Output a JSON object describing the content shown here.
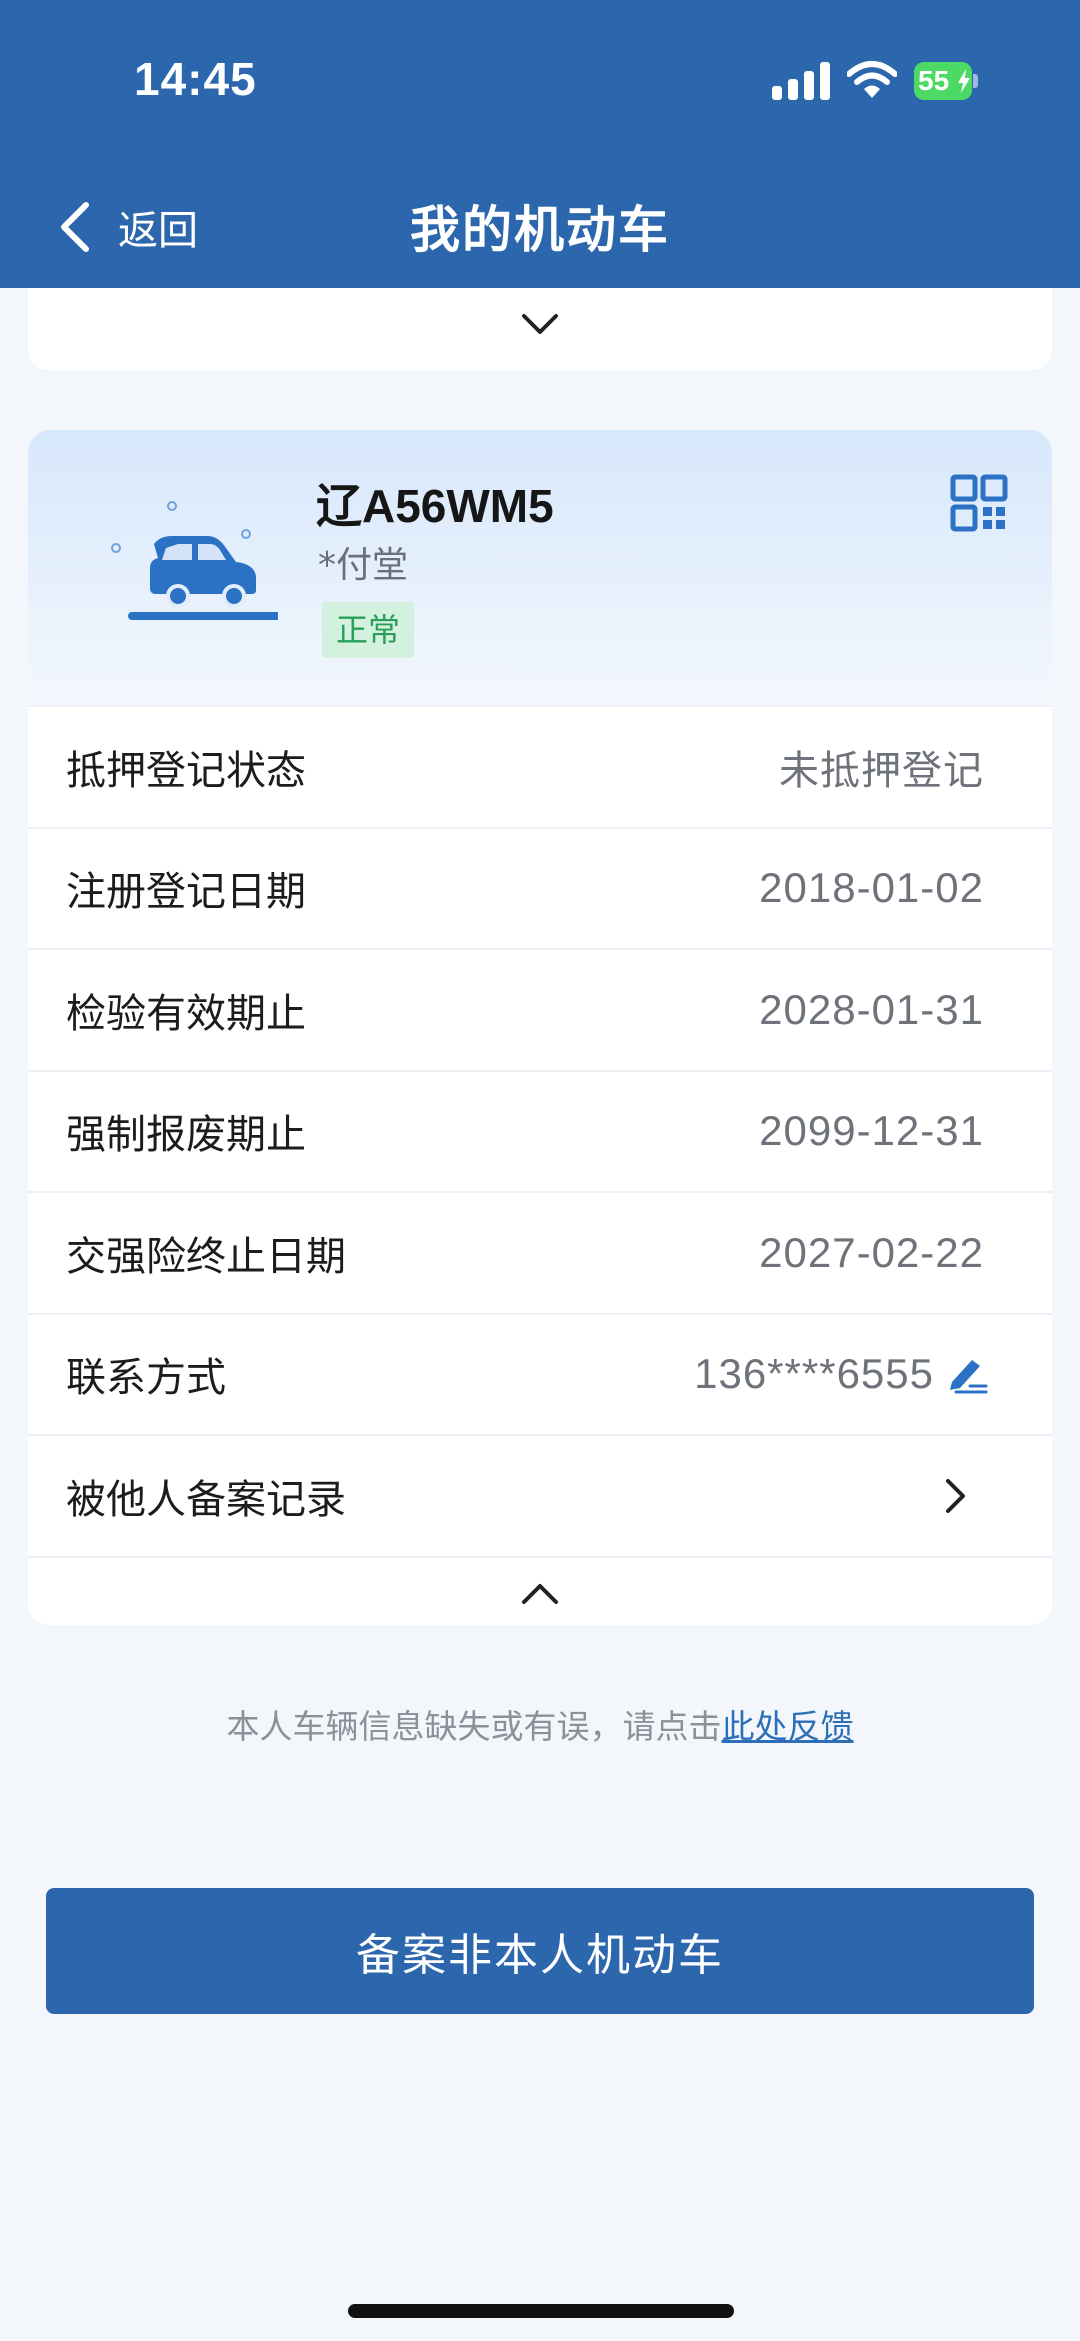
{
  "status_bar": {
    "time": "14:45",
    "battery": "55"
  },
  "nav": {
    "back_label": "返回",
    "title": "我的机动车"
  },
  "vehicle": {
    "plate": "辽A56WM5",
    "owner": "*付堂",
    "status": "正常"
  },
  "info_rows": [
    {
      "label": "抵押登记状态",
      "value": "未抵押登记"
    },
    {
      "label": "注册登记日期",
      "value": "2018-01-02"
    },
    {
      "label": "检验有效期止",
      "value": "2028-01-31"
    },
    {
      "label": "强制报废期止",
      "value": "2099-12-31"
    },
    {
      "label": "交强险终止日期",
      "value": "2027-02-22"
    },
    {
      "label": "联系方式",
      "value": "136****6555"
    },
    {
      "label": "被他人备案记录",
      "value": ""
    }
  ],
  "feedback": {
    "text": "本人车辆信息缺失或有误，请点击",
    "link": "此处反馈"
  },
  "primary_button": {
    "label": "备案非本人机动车"
  },
  "colors": {
    "brand": "#2c66ad",
    "badge_bg": "#d4f0de",
    "badge_text": "#2b9f5a"
  },
  "icons": [
    "signal-icon",
    "wifi-icon",
    "battery-icon",
    "back-chevron-icon",
    "expand-chevron-icon",
    "car-icon",
    "qr-code-icon",
    "edit-icon",
    "chevron-right-icon",
    "collapse-chevron-icon"
  ]
}
